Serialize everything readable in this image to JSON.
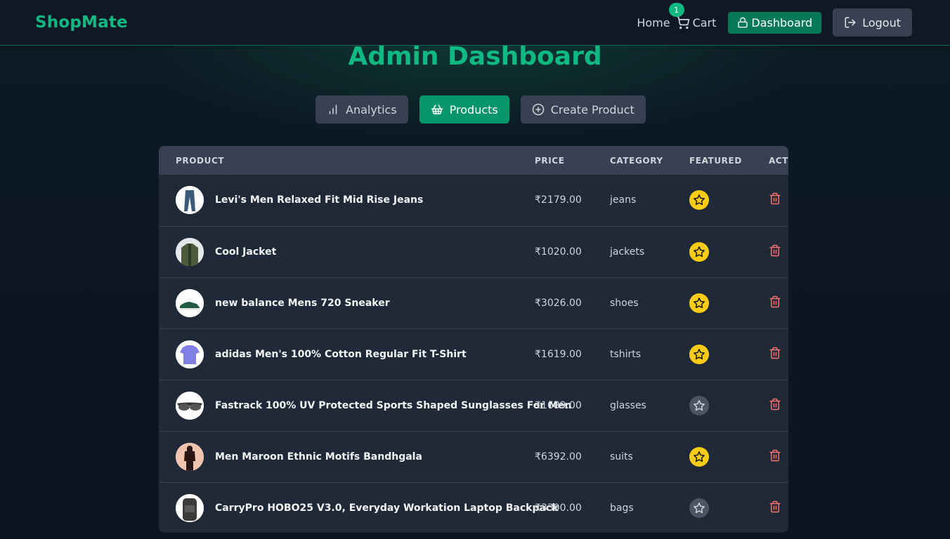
{
  "nav": {
    "brand": "ShopMate",
    "home": "Home",
    "cart_label": "Cart",
    "cart_count": "1",
    "dashboard": "Dashboard",
    "logout": "Logout"
  },
  "page": {
    "title": "Admin Dashboard"
  },
  "tabs": [
    {
      "label": "Analytics",
      "icon": "bar-chart-icon",
      "active": false
    },
    {
      "label": "Products",
      "icon": "basket-icon",
      "active": true
    },
    {
      "label": "Create Product",
      "icon": "plus-circle-icon",
      "active": false
    }
  ],
  "table": {
    "headers": [
      "PRODUCT",
      "PRICE",
      "CATEGORY",
      "FEATURED",
      "ACTI"
    ],
    "rows": [
      {
        "name": "Levi's Men Relaxed Fit Mid Rise Jeans",
        "price": "₹2179.00",
        "category": "jeans",
        "featured": true
      },
      {
        "name": "Cool Jacket",
        "price": "₹1020.00",
        "category": "jackets",
        "featured": true
      },
      {
        "name": "new balance Mens 720 Sneaker",
        "price": "₹3026.00",
        "category": "shoes",
        "featured": true
      },
      {
        "name": "adidas Men's 100% Cotton Regular Fit T-Shirt",
        "price": "₹1619.00",
        "category": "tshirts",
        "featured": true
      },
      {
        "name": "Fastrack 100% UV Protected Sports Shaped Sunglasses For Men",
        "price": "₹1689.00",
        "category": "glasses",
        "featured": false
      },
      {
        "name": "Men Maroon Ethnic Motifs Bandhgala",
        "price": "₹6392.00",
        "category": "suits",
        "featured": true
      },
      {
        "name": "CarryPro HOBO25 V3.0, Everyday Workation Laptop Backpack",
        "price": "₹3390.00",
        "category": "bags",
        "featured": false
      }
    ]
  },
  "colors": {
    "accent": "#10b981",
    "featured_on": "#facc15",
    "featured_off": "#4b5563",
    "delete": "#f87171"
  }
}
